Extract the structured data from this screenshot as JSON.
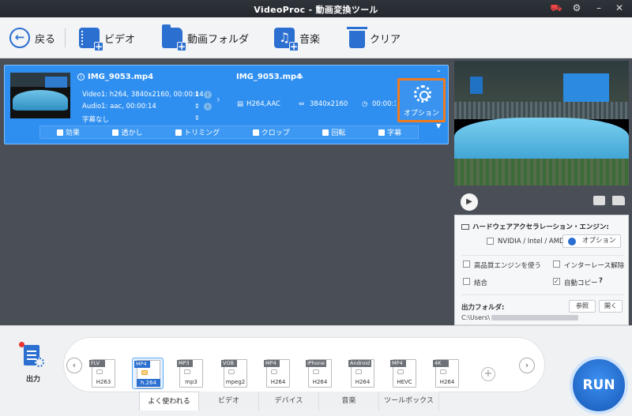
{
  "app": {
    "title": "VideoProc - 動画変換ツール"
  },
  "toolbar": {
    "back": "戻る",
    "video": "ビデオ",
    "folder": "動画フォルダ",
    "music": "音楽",
    "clear": "クリア"
  },
  "item": {
    "source_name": "IMG_9053.mp4",
    "video_line": "Video1: h264, 3840x2160, 00:00:14",
    "audio_line": "Audio1: aac, 00:00:14",
    "subtitle_line": "字幕なし",
    "output_name": "IMG_9053.mp4",
    "codec": "H264,AAC",
    "resolution": "3840x2160",
    "duration": "00:00:14",
    "options_label": "オプション",
    "tools": [
      "効果",
      "透かし",
      "トリミング",
      "クロップ",
      "回転",
      "字幕"
    ]
  },
  "settings": {
    "hw_title": "ハードウェアアクセラレーション・エンジン:",
    "hw_option": "NVIDIA / Intel / AMD",
    "options_button": "オプション",
    "hq_engine": "高品質エンジンを使う",
    "deinterlace": "インターレース解除",
    "merge": "結合",
    "auto_copy": "自動コピー",
    "auto_copy_help": "?",
    "output_folder_label": "出力フォルダ:",
    "browse": "参照",
    "open": "開く",
    "path_prefix": "C:\\Users\\"
  },
  "output_button": "出力",
  "formats": [
    {
      "tag": "FLV",
      "codec": "H263"
    },
    {
      "tag": "MP4",
      "codec": "h.264"
    },
    {
      "tag": "MP3",
      "codec": "mp3"
    },
    {
      "tag": "VOB",
      "codec": "mpeg2"
    },
    {
      "tag": "MP4",
      "codec": "H264"
    },
    {
      "tag": "iPhone",
      "codec": "H264"
    },
    {
      "tag": "Android",
      "codec": "H264"
    },
    {
      "tag": "MP4",
      "codec": "HEVC"
    },
    {
      "tag": "4K",
      "codec": "H264"
    }
  ],
  "selected_format_index": 1,
  "tabs": [
    "よく使われる",
    "ビデオ",
    "デバイス",
    "音楽",
    "ツールボックス"
  ],
  "active_tab_index": 0,
  "run_label": "RUN",
  "colors": {
    "accent": "#2b6fd0",
    "highlight": "#f07a1c",
    "item_bg": "#2f8ff0"
  }
}
